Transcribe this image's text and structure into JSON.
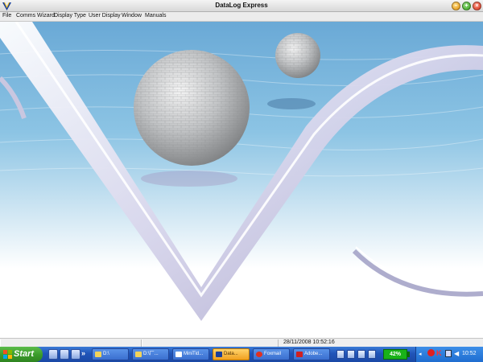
{
  "window": {
    "title": "DataLog Express"
  },
  "menu": [
    "File",
    "Comms Wizard",
    "Display Type",
    "User Display",
    "Window",
    "Manuals"
  ],
  "status": {
    "datetime": "28/11/2008 10:52:16"
  },
  "taskbar": {
    "start_label": "Start",
    "quicklaunch_chevron": "»",
    "buttons": [
      {
        "label": "D:\\",
        "icon": "folder-icon"
      },
      {
        "label": "D:\\厂...",
        "icon": "folder-icon"
      },
      {
        "label": "MiniTid...",
        "icon": "document-icon"
      },
      {
        "label": "Data...",
        "icon": "datalog-icon",
        "active": true
      },
      {
        "label": "Foxmail",
        "icon": "foxmail-icon"
      },
      {
        "label": "Adobe...",
        "icon": "adobe-icon"
      }
    ],
    "battery_percent": "42%",
    "clock": "10:52"
  },
  "colors": {
    "taskbar_blue": "#2054b8",
    "start_green": "#3a9a2a",
    "active_task": "#f0a020",
    "battery_green": "#19b219"
  }
}
